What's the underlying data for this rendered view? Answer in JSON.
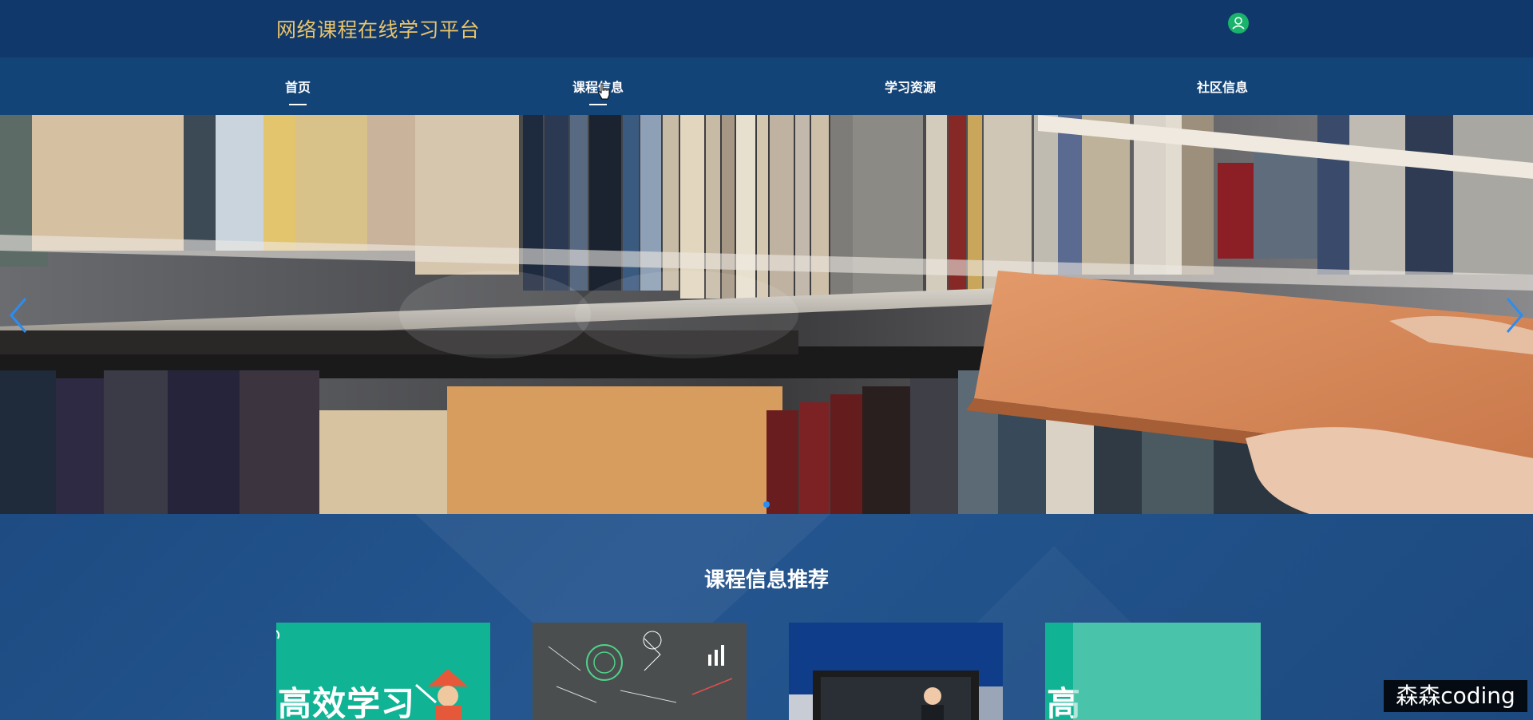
{
  "header": {
    "site_title": "网络课程在线学习平台",
    "user_icon": "user-icon"
  },
  "nav": {
    "items": [
      {
        "label": "首页",
        "active": true
      },
      {
        "label": "课程信息",
        "active": false
      },
      {
        "label": "学习资源",
        "active": false
      },
      {
        "label": "社区信息",
        "active": false
      }
    ]
  },
  "banner": {
    "prev_icon": "chevron-left-icon",
    "next_icon": "chevron-right-icon",
    "active_slide": 1,
    "slide_count": 1,
    "accent_color": "#2d8cf0"
  },
  "recommend": {
    "title": "课程信息推荐",
    "cards": [
      {
        "text": "高效学习",
        "bg": "#10b394"
      },
      {
        "text": "",
        "bg": "#4b4e4e"
      },
      {
        "text": "",
        "bg": "#0f3d8a"
      },
      {
        "text": "高",
        "bg": "#10b394"
      }
    ]
  },
  "watermark": {
    "text": "森森coding"
  }
}
